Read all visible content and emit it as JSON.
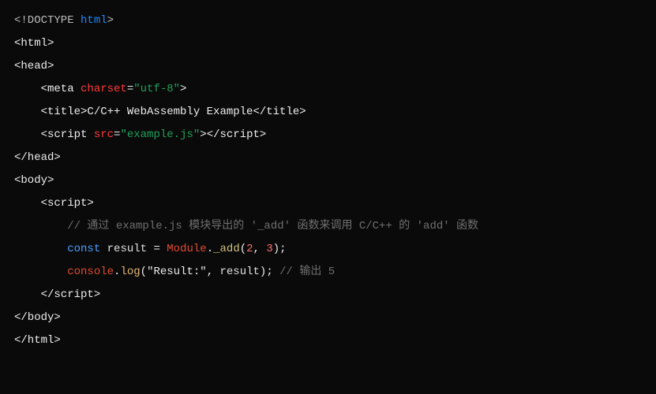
{
  "code": {
    "lines": [
      {
        "tokens": [
          {
            "t": "<!DOCTYPE ",
            "c": "c-gray"
          },
          {
            "t": "html",
            "c": "c-blue"
          },
          {
            "t": ">",
            "c": "c-gray"
          }
        ]
      },
      {
        "tokens": [
          {
            "t": "<html>",
            "c": "c-white"
          }
        ]
      },
      {
        "tokens": [
          {
            "t": "<head>",
            "c": "c-white"
          }
        ]
      },
      {
        "tokens": [
          {
            "t": "    <meta ",
            "c": "c-white"
          },
          {
            "t": "charset",
            "c": "c-red"
          },
          {
            "t": "=",
            "c": "c-white"
          },
          {
            "t": "\"utf-8\"",
            "c": "c-green"
          },
          {
            "t": ">",
            "c": "c-white"
          }
        ]
      },
      {
        "tokens": [
          {
            "t": "    <title>C/C++ WebAssembly Example</title>",
            "c": "c-white"
          }
        ]
      },
      {
        "tokens": [
          {
            "t": "    <script ",
            "c": "c-white"
          },
          {
            "t": "src",
            "c": "c-red"
          },
          {
            "t": "=",
            "c": "c-white"
          },
          {
            "t": "\"example.js\"",
            "c": "c-green"
          },
          {
            "t": ">",
            "c": "c-white"
          },
          {
            "t": "</script>",
            "c": "c-white"
          }
        ]
      },
      {
        "tokens": [
          {
            "t": "</head>",
            "c": "c-white"
          }
        ]
      },
      {
        "tokens": [
          {
            "t": "<body>",
            "c": "c-white"
          }
        ]
      },
      {
        "tokens": [
          {
            "t": "    <script>",
            "c": "c-white"
          }
        ]
      },
      {
        "tokens": [
          {
            "t": "        // 通过 example.js 模块导出的 '_add' 函数来调用 C/C++ 的 'add' 函数",
            "c": "c-comm"
          }
        ]
      },
      {
        "tokens": [
          {
            "t": "        ",
            "c": "c-white"
          },
          {
            "t": "const",
            "c": "c-keyword"
          },
          {
            "t": " ",
            "c": "c-white"
          },
          {
            "t": "result",
            "c": "c-ident"
          },
          {
            "t": " = ",
            "c": "c-white"
          },
          {
            "t": "Module",
            "c": "c-module"
          },
          {
            "t": ".",
            "c": "c-white"
          },
          {
            "t": "_add",
            "c": "c-yellowish"
          },
          {
            "t": "(",
            "c": "c-white"
          },
          {
            "t": "2",
            "c": "c-number"
          },
          {
            "t": ", ",
            "c": "c-white"
          },
          {
            "t": "3",
            "c": "c-number"
          },
          {
            "t": ");",
            "c": "c-white"
          }
        ]
      },
      {
        "tokens": [
          {
            "t": "        ",
            "c": "c-white"
          },
          {
            "t": "console",
            "c": "c-module"
          },
          {
            "t": ".",
            "c": "c-white"
          },
          {
            "t": "log",
            "c": "c-func"
          },
          {
            "t": "(",
            "c": "c-white"
          },
          {
            "t": "\"Result:\"",
            "c": "c-string"
          },
          {
            "t": ", ",
            "c": "c-white"
          },
          {
            "t": "result",
            "c": "c-ident"
          },
          {
            "t": "); ",
            "c": "c-white"
          },
          {
            "t": "// 输出 5",
            "c": "c-comm"
          }
        ]
      },
      {
        "tokens": [
          {
            "t": "    </script>",
            "c": "c-white"
          }
        ]
      },
      {
        "tokens": [
          {
            "t": "</body>",
            "c": "c-white"
          }
        ]
      },
      {
        "tokens": [
          {
            "t": "</html>",
            "c": "c-white"
          }
        ]
      }
    ]
  }
}
